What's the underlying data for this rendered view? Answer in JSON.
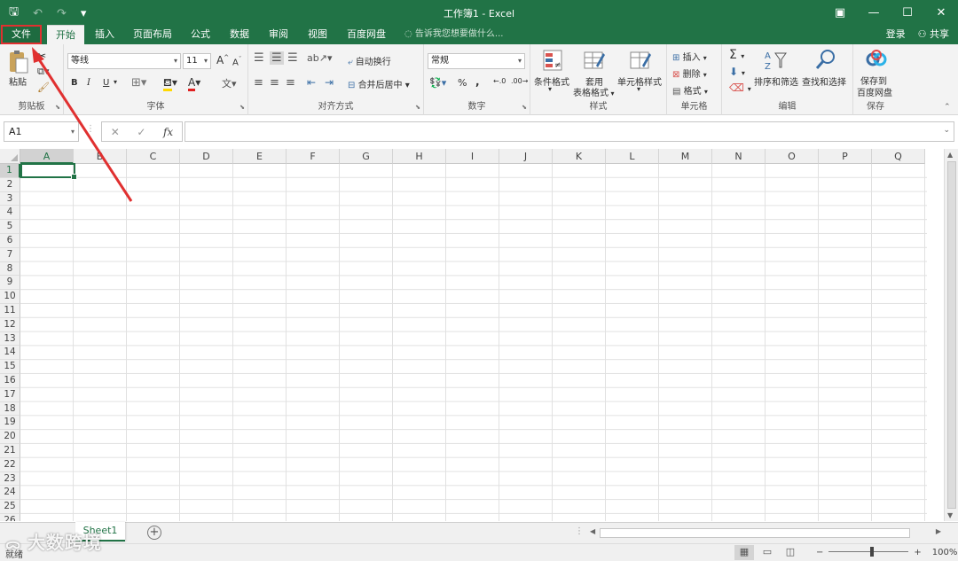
{
  "window": {
    "title": "工作簿1 - Excel",
    "qat_save_icon": "🖫",
    "qat_undo": "↶",
    "qat_redo": "↷",
    "qat_more": "▾",
    "ribbon_display_icon": "▣",
    "minimize": "—",
    "maximize": "☐",
    "close": "✕"
  },
  "tabs": [
    "文件",
    "开始",
    "插入",
    "页面布局",
    "公式",
    "数据",
    "审阅",
    "视图",
    "百度网盘"
  ],
  "tellme": "告诉我您想要做什么...",
  "account": {
    "login": "登录",
    "share": "共享"
  },
  "ribbon": {
    "clipboard": {
      "label": "剪贴板",
      "paste": "粘贴"
    },
    "font": {
      "label": "字体",
      "name": "等线",
      "size": "11",
      "grow": "A",
      "shrink": "A",
      "bold": "B",
      "italic": "I",
      "underline": "U"
    },
    "alignment": {
      "label": "对齐方式",
      "wrap": "自动换行",
      "merge": "合并后居中"
    },
    "number": {
      "label": "数字",
      "format": "常规",
      "percent": "%",
      "comma": ","
    },
    "styles": {
      "label": "样式",
      "conditional": "条件格式",
      "table_fmt_1": "套用",
      "table_fmt_2": "表格格式",
      "cell_styles": "单元格样式"
    },
    "cells": {
      "label": "单元格",
      "insert": "插入",
      "delete": "删除",
      "format": "格式"
    },
    "editing": {
      "label": "编辑",
      "sort": "排序和筛选",
      "find": "查找和选择"
    },
    "save": {
      "label": "保存",
      "save_1": "保存到",
      "save_2": "百度网盘"
    }
  },
  "formula_bar": {
    "name_box": "A1",
    "cancel": "✕",
    "enter": "✓",
    "fx": "fx"
  },
  "columns": [
    "A",
    "B",
    "C",
    "D",
    "E",
    "F",
    "G",
    "H",
    "I",
    "J",
    "K",
    "L",
    "M",
    "N",
    "O",
    "P",
    "Q"
  ],
  "rows": [
    "1",
    "2",
    "3",
    "4",
    "5",
    "6",
    "7",
    "8",
    "9",
    "10",
    "11",
    "12",
    "13",
    "14",
    "15",
    "16",
    "17",
    "18",
    "19",
    "20",
    "21",
    "22",
    "23",
    "24",
    "25",
    "26"
  ],
  "sheet": {
    "tab": "Sheet1",
    "add": "+"
  },
  "status": {
    "ready": "就绪",
    "zoom": "100%",
    "zoom_out": "−",
    "zoom_in": "+"
  },
  "watermark": "大数跨境",
  "colors": {
    "excel_green": "#217346",
    "annotation_red": "#e03030"
  }
}
